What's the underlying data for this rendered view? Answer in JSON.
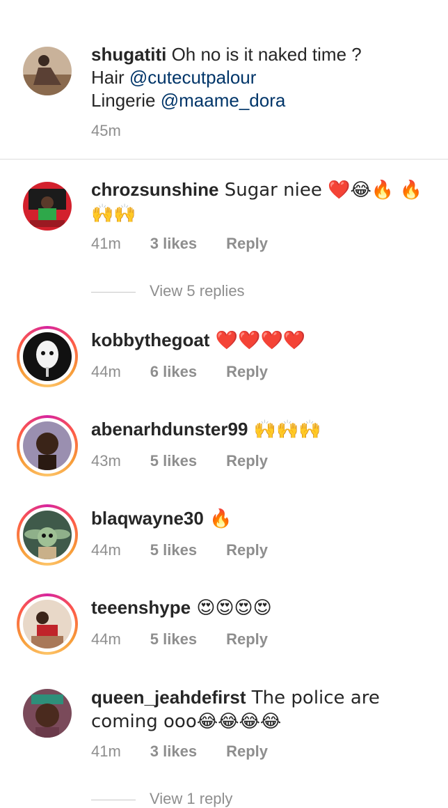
{
  "caption": {
    "username": "shugatiti",
    "text": " Oh no is it naked time ?",
    "line2_prefix": "Hair ",
    "line2_mention": "@cutecutpalour",
    "line3_prefix": "Lingerie ",
    "line3_mention": "@maame_dora",
    "time": "45m"
  },
  "comments": [
    {
      "username": "chrozsunshine",
      "text": " Sugar niee ❤️😂🔥 🔥 🙌🙌",
      "time": "41m",
      "likes": "3 likes",
      "reply": "Reply"
    },
    {
      "username": "kobbythegoat",
      "text": " ❤️❤️❤️❤️",
      "time": "44m",
      "likes": "6 likes",
      "reply": "Reply"
    },
    {
      "username": "abenarhdunster99",
      "text": " 🙌🙌🙌",
      "time": "43m",
      "likes": "5 likes",
      "reply": "Reply"
    },
    {
      "username": "blaqwayne30",
      "text": " 🔥",
      "time": "44m",
      "likes": "5 likes",
      "reply": "Reply"
    },
    {
      "username": "teeenshype",
      "text": " 😍😍😍😍",
      "time": "44m",
      "likes": "5 likes",
      "reply": "Reply"
    },
    {
      "username": "queen_jeahdefirst",
      "text": " The police are coming ooo😂😂😂😂",
      "time": "41m",
      "likes": "3 likes",
      "reply": "Reply"
    }
  ],
  "view_replies_1": "View 5 replies",
  "view_replies_2": "View 1 reply",
  "colors": {
    "mention": "#003569",
    "meta": "#8e8e8e",
    "ring": "#fd5949"
  }
}
